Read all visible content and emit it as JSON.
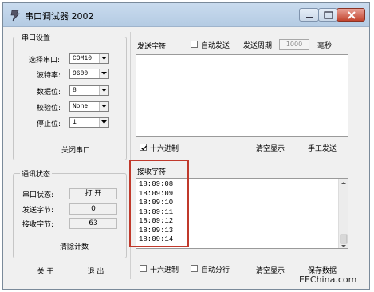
{
  "window": {
    "title": "串口调试器 2002"
  },
  "port_settings": {
    "legend": "串口设置",
    "port_label": "选择串口:",
    "port_value": "COM10",
    "baud_label": "波特率:",
    "baud_value": "9600",
    "databits_label": "数据位:",
    "databits_value": "8",
    "parity_label": "校验位:",
    "parity_value": "None",
    "stopbits_label": "停止位:",
    "stopbits_value": "1",
    "close_port_button": "关闭串口"
  },
  "comm_status": {
    "legend": "通讯状态",
    "port_status_label": "串口状态:",
    "port_status_value": "打 开",
    "sent_label": "发送字节:",
    "sent_value": "0",
    "received_label": "接收字节:",
    "received_value": "63",
    "clear_count_button": "清除计数"
  },
  "bottom_left": {
    "about_button": "关 于",
    "exit_button": "退 出"
  },
  "send": {
    "label": "发送字符:",
    "auto_send_label": "自动发送",
    "auto_send_checked": false,
    "period_label": "发送周期",
    "period_value": "1000",
    "period_unit": "毫秒",
    "hex_label": "十六进制",
    "hex_checked": true,
    "clear_button": "清空显示",
    "manual_send_button": "手工发送"
  },
  "receive": {
    "label": "接收字符:",
    "lines": [
      "18:09:08",
      "18:09:09",
      "18:09:10",
      "18:09:11",
      "18:09:12",
      "18:09:13",
      "18:09:14"
    ],
    "hex_label": "十六进制",
    "hex_checked": false,
    "auto_wrap_label": "自动分行",
    "auto_wrap_checked": false,
    "clear_button": "清空显示",
    "save_button": "保存数据"
  },
  "watermark": "EEChina.com",
  "colors": {
    "highlight_box": "#c0392b",
    "window_bg": "#f0f0f0"
  }
}
